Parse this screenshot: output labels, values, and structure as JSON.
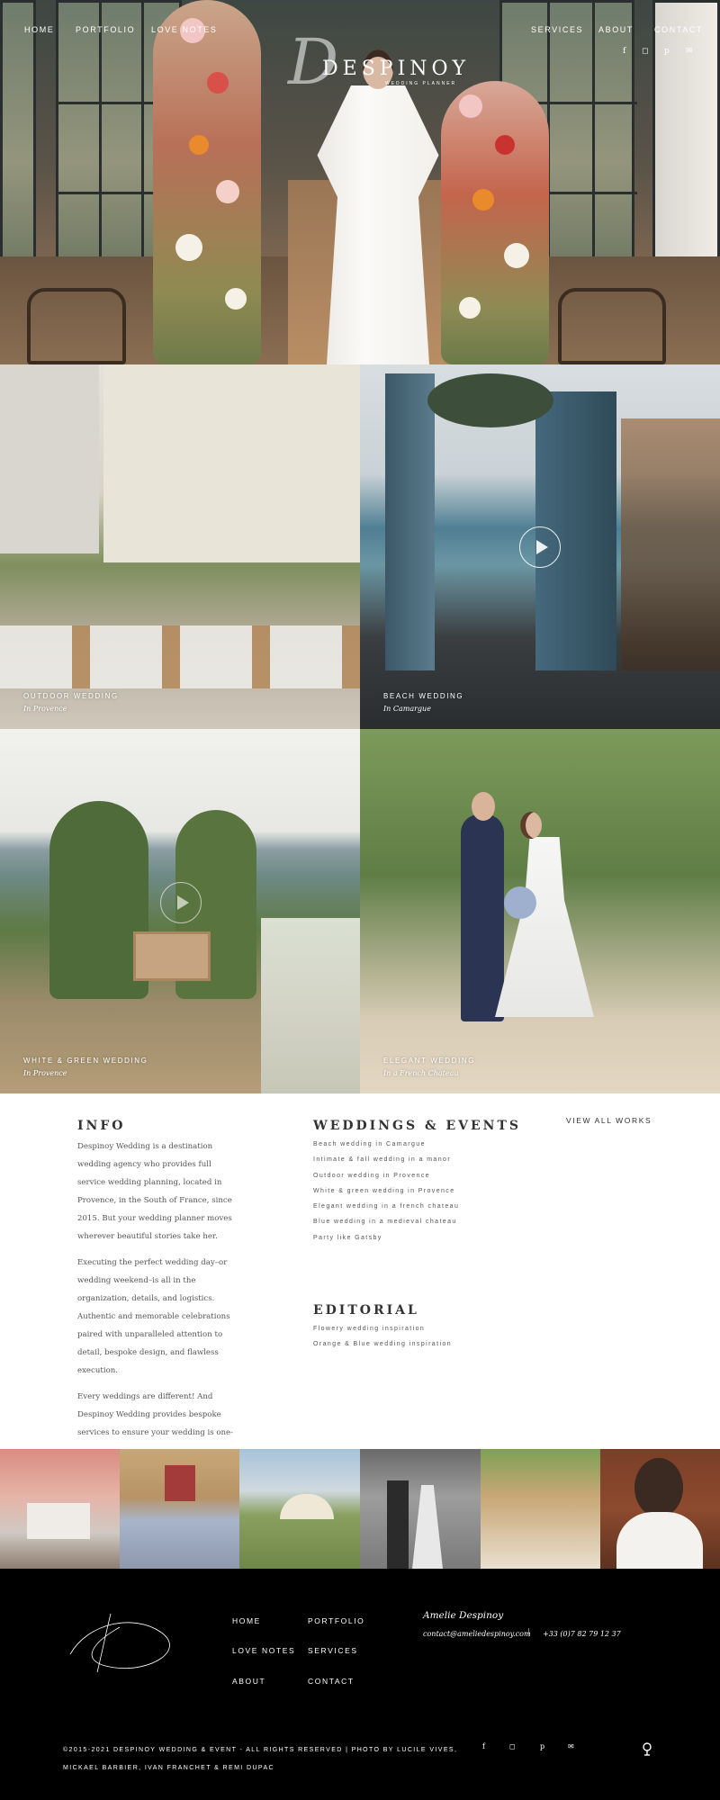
{
  "nav": {
    "left": [
      "HOME",
      "PORTFOLIO",
      "LOVE NOTES"
    ],
    "right": [
      "SERVICES",
      "ABOUT",
      "CONTACT"
    ]
  },
  "logo": {
    "text": "DESPINOY",
    "sub": "WEDDING PLANNER",
    "mark": "D"
  },
  "social_icons": [
    "facebook-icon",
    "instagram-icon",
    "pinterest-icon",
    "email-icon"
  ],
  "tiles": [
    {
      "title": "OUTDOOR WEDDING",
      "subtitle": "In Provence"
    },
    {
      "title": "BEACH WEDDING",
      "subtitle": "In Camargue"
    },
    {
      "title": "WHITE & GREEN WEDDING",
      "subtitle": "In Provence"
    },
    {
      "title": "ELEGANT WEDDING",
      "subtitle": "In a French Chateau"
    }
  ],
  "info": {
    "heading": "INFO",
    "paragraphs": [
      "Despinoy Wedding is a destination wedding agency who provides full service wedding planning, located in Provence, in the South of France, since 2015. But your wedding planner moves wherever beautiful stories take her.",
      "Executing the perfect wedding day–or wedding weekend–is all in the organization, details, and logistics. Authentic and memorable celebrations paired with unparalleled attention to detail, bespoke design, and flawless execution.",
      "Every weddings are different! And Despinoy Wedding provides bespoke services to ensure your wedding is one-of-a-kind. Whether in a Bastide in Provence among the"
    ]
  },
  "weddings": {
    "heading": "WEDDINGS & EVENTS",
    "items": [
      "Beach wedding in Camargue",
      "Intimate & fall wedding in a manor",
      "Outdoor wedding in Provence",
      "White & green wedding in Provence",
      "Elegant wedding in a french chateau",
      "Blue wedding in a medieval chateau",
      "Party like Gatsby"
    ]
  },
  "editorial": {
    "heading": "EDITORIAL",
    "items": [
      "Flowery wedding inspiration",
      "Orange & Blue wedding inspiration"
    ]
  },
  "view_all": "VIEW ALL WORKS",
  "footer": {
    "nav": [
      "HOME",
      "PORTFOLIO",
      "LOVE NOTES",
      "SERVICES",
      "ABOUT",
      "CONTACT"
    ],
    "contact_name": "Amelie Despinoy",
    "email": "contact@ameliedespinoy.com",
    "separator": "|",
    "phone": "+33 (0)7 82 79 12 37",
    "copyright": "©2015-2021 DESPINOY WEDDING & EVENT - ALL RIGHTS RESERVED | PHOTO BY LUCILE VIVES, MICKAEL BARBIER, IVAN FRANCHET & REMI DUPAC"
  }
}
